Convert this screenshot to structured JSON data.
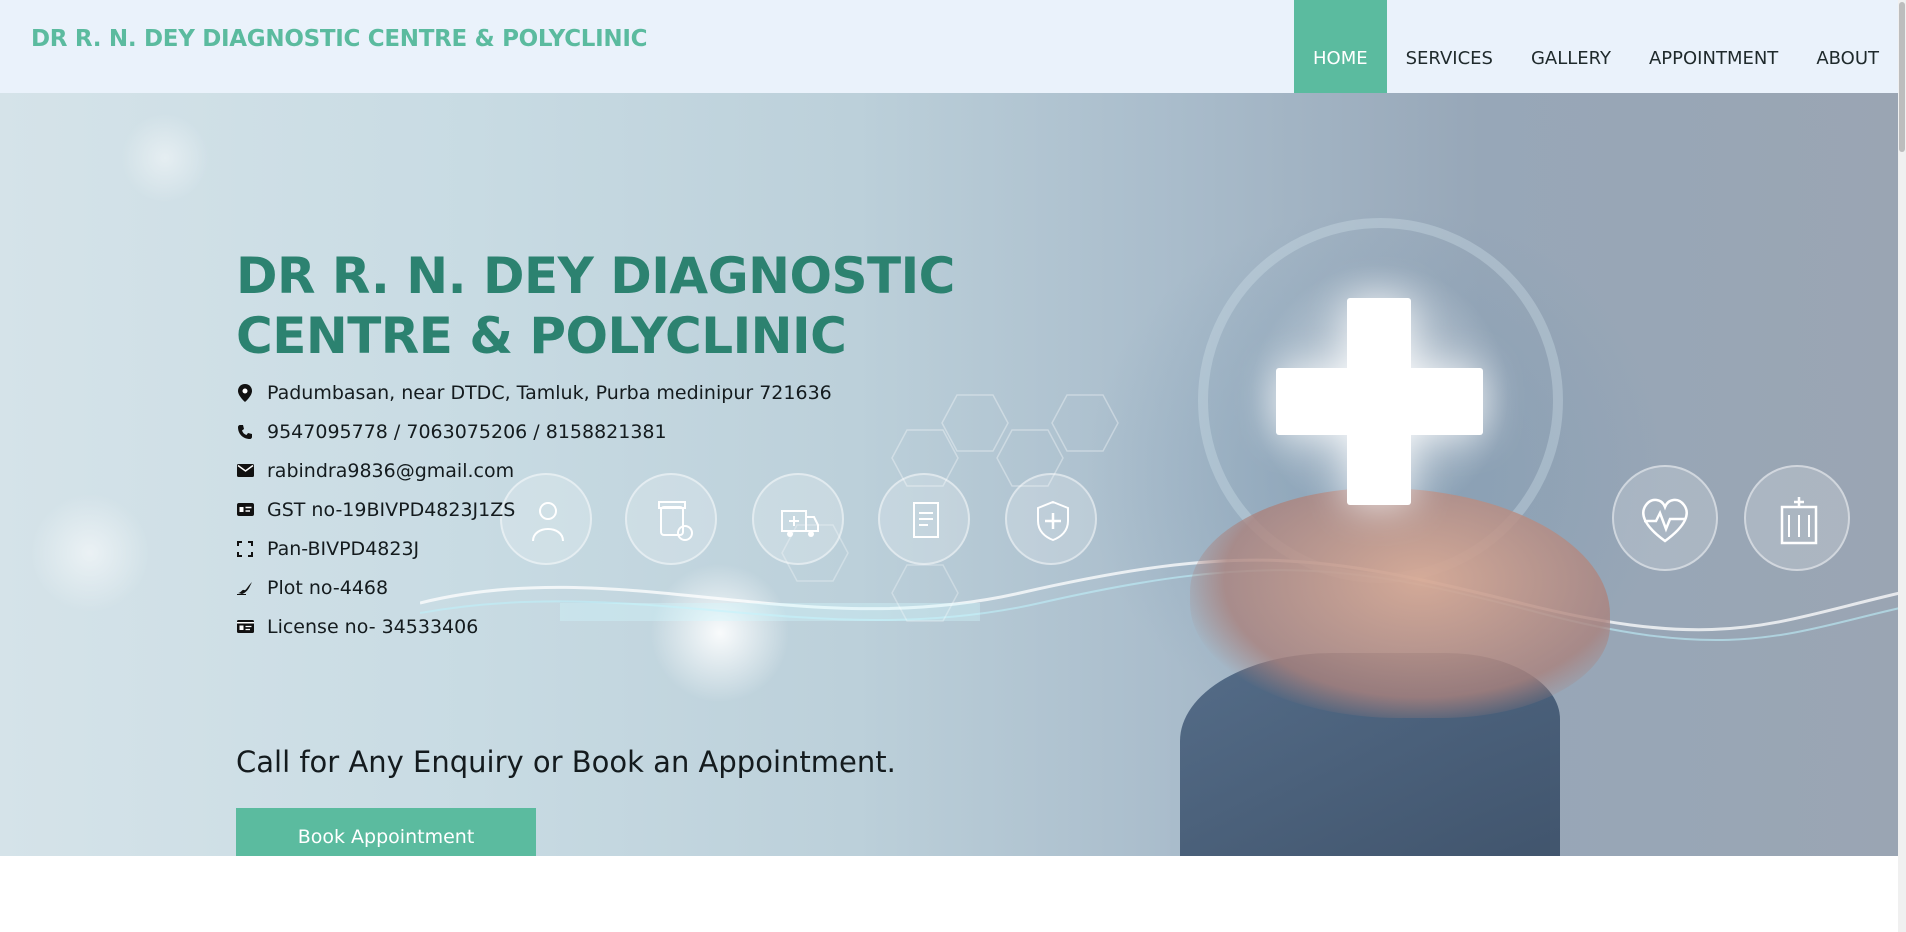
{
  "header": {
    "brand": "DR R. N. DEY DIAGNOSTIC CENTRE & POLYCLINIC",
    "nav": [
      {
        "label": "HOME",
        "active": true
      },
      {
        "label": "SERVICES",
        "active": false
      },
      {
        "label": "GALLERY",
        "active": false
      },
      {
        "label": "APPOINTMENT",
        "active": false
      },
      {
        "label": "ABOUT",
        "active": false
      }
    ]
  },
  "hero": {
    "title_line1": "DR R. N. DEY DIAGNOSTIC",
    "title_line2": "CENTRE & POLYCLINIC",
    "info": [
      {
        "icon": "location-pin-icon",
        "text": "Padumbasan, near DTDC, Tamluk, Purba medinipur 721636"
      },
      {
        "icon": "phone-icon",
        "text": "9547095778 / 7063075206 / 8158821381"
      },
      {
        "icon": "envelope-icon",
        "text": "rabindra9836@gmail.com"
      },
      {
        "icon": "id-card-icon",
        "text": "GST no-19BIVPD4823J1ZS"
      },
      {
        "icon": "scan-frame-icon",
        "text": "Pan-BIVPD4823J"
      },
      {
        "icon": "signature-icon",
        "text": "Plot no-4468"
      },
      {
        "icon": "license-card-icon",
        "text": "License no- 34533406"
      }
    ],
    "enquiry": "Call for Any Enquiry or Book an Appointment.",
    "cta_label": "Book Appointment"
  },
  "colors": {
    "accent": "#5bbb9f",
    "title": "#2c8270",
    "header_bg": "#eaf2fb"
  }
}
